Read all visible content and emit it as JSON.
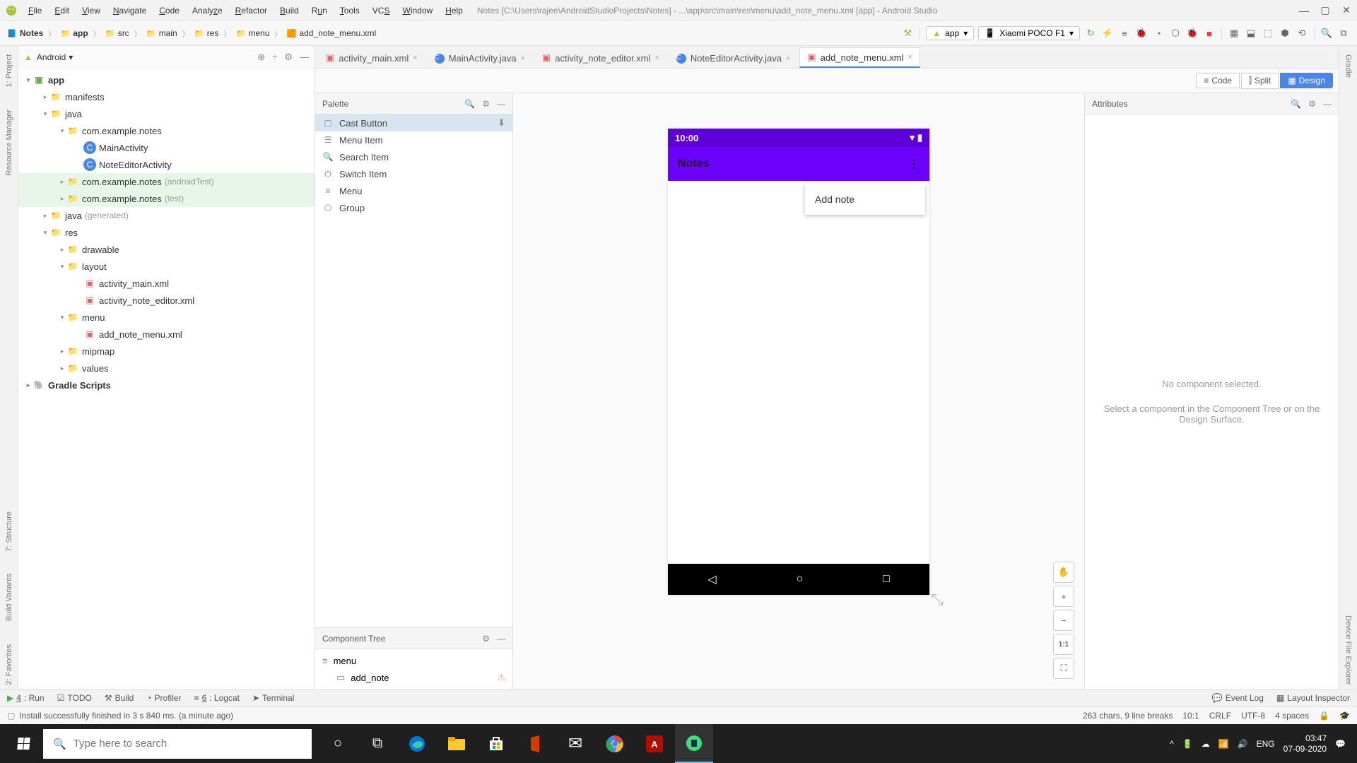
{
  "titlebar": {
    "menus": [
      "File",
      "Edit",
      "View",
      "Navigate",
      "Code",
      "Analyze",
      "Refactor",
      "Build",
      "Run",
      "Tools",
      "VCS",
      "Window",
      "Help"
    ],
    "title": "Notes [C:\\Users\\rajee\\AndroidStudioProjects\\Notes] - ...\\app\\src\\main\\res\\menu\\add_note_menu.xml [app] - Android Studio"
  },
  "breadcrumbs": [
    "Notes",
    "app",
    "src",
    "main",
    "res",
    "menu",
    "add_note_menu.xml"
  ],
  "toolbar": {
    "app_config": "app",
    "device": "Xiaomi POCO F1"
  },
  "project_panel": {
    "view": "Android",
    "tree": {
      "root": "app",
      "manifests": "manifests",
      "java": "java",
      "pkg_main": "com.example.notes",
      "main_activity": "MainActivity",
      "note_editor_activity": "NoteEditorActivity",
      "pkg_android_test": "com.example.notes",
      "pkg_android_test_q": "(androidTest)",
      "pkg_test": "com.example.notes",
      "pkg_test_q": "(test)",
      "java_gen": "java",
      "java_gen_q": "(generated)",
      "res": "res",
      "drawable": "drawable",
      "layout": "layout",
      "layout_1": "activity_main.xml",
      "layout_2": "activity_note_editor.xml",
      "menu": "menu",
      "menu_1": "add_note_menu.xml",
      "mipmap": "mipmap",
      "values": "values",
      "gradle": "Gradle Scripts"
    }
  },
  "tabs": [
    {
      "label": "activity_main.xml",
      "type": "xml"
    },
    {
      "label": "MainActivity.java",
      "type": "java"
    },
    {
      "label": "activity_note_editor.xml",
      "type": "xml"
    },
    {
      "label": "NoteEditorActivity.java",
      "type": "java"
    },
    {
      "label": "add_note_menu.xml",
      "type": "xml",
      "active": true
    }
  ],
  "design_switch": {
    "code": "Code",
    "split": "Split",
    "design": "Design"
  },
  "palette": {
    "title": "Palette",
    "items": [
      "Cast Button",
      "Menu Item",
      "Search Item",
      "Switch Item",
      "Menu",
      "Group"
    ]
  },
  "component_tree": {
    "title": "Component Tree",
    "root": "menu",
    "child": "add_note"
  },
  "preview": {
    "time": "10:00",
    "app_title": "Notes",
    "menu_item": "Add note"
  },
  "attributes": {
    "title": "Attributes",
    "empty_1": "No component selected.",
    "empty_2": "Select a component in the Component Tree or on the Design Surface."
  },
  "left_gutter": [
    "1: Project",
    "Resource Manager",
    "7: Structure",
    "Build Variants",
    "2: Favorites"
  ],
  "right_gutter": [
    "Gradle",
    "Device File Explorer"
  ],
  "bottom_tools": {
    "left": [
      "4: Run",
      "TODO",
      "Build",
      "Profiler",
      "6: Logcat",
      "Terminal"
    ],
    "right": [
      "Event Log",
      "Layout Inspector"
    ]
  },
  "status": {
    "msg": "Install successfully finished in 3 s 840 ms. (a minute ago)",
    "chars": "263 chars, 9 line breaks",
    "pos": "10:1",
    "crlf": "CRLF",
    "enc": "UTF-8",
    "indent": "4 spaces"
  },
  "taskbar": {
    "search_placeholder": "Type here to search",
    "lang": "ENG",
    "time": "03:47",
    "date": "07-09-2020"
  }
}
